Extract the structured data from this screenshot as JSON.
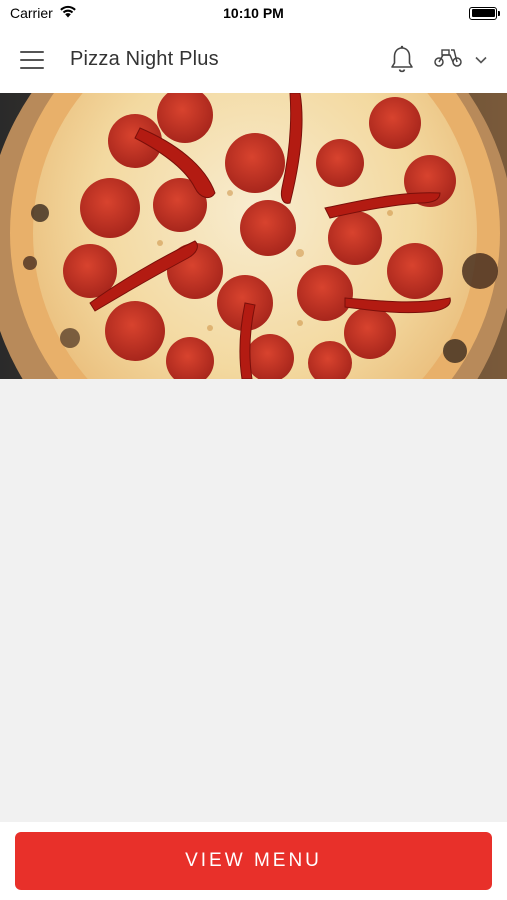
{
  "status_bar": {
    "carrier": "Carrier",
    "time": "10:10 PM"
  },
  "header": {
    "title": "Pizza Night Plus",
    "icons": [
      "hamburger-menu-icon",
      "bell-icon",
      "scooter-icon",
      "chevron-down-icon"
    ]
  },
  "hero": {
    "image": "pepperoni-pizza-with-red-chili-peppers"
  },
  "footer": {
    "view_menu_label": "VIEW MENU"
  },
  "colors": {
    "accent": "#e8302a",
    "background": "#f1f1f1",
    "header": "#ffffff"
  }
}
